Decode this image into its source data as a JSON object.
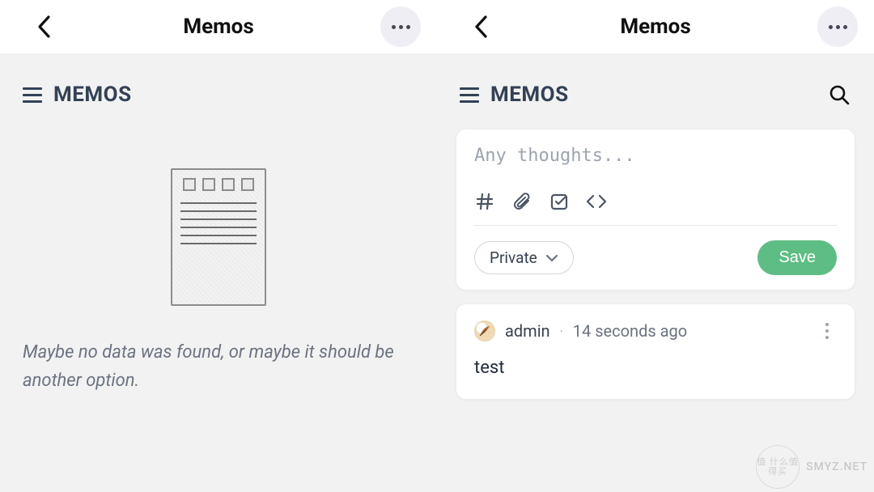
{
  "left": {
    "nav_title": "Memos",
    "section_title": "MEMOS",
    "empty_message": "Maybe no data was found, or maybe it should be another option."
  },
  "right": {
    "nav_title": "Memos",
    "section_title": "MEMOS",
    "composer": {
      "placeholder": "Any thoughts...",
      "value": "",
      "privacy_label": "Private",
      "save_label": "Save"
    },
    "memos": [
      {
        "user": "admin",
        "time": "14 seconds ago",
        "content": "test"
      }
    ]
  },
  "colors": {
    "accent": "#5ebd84",
    "bg": "#f2f2f2",
    "card": "#ffffff",
    "text_muted": "#6b7280"
  },
  "watermark": {
    "text": "SMYZ.NET",
    "badge": "值 什么值得买"
  }
}
